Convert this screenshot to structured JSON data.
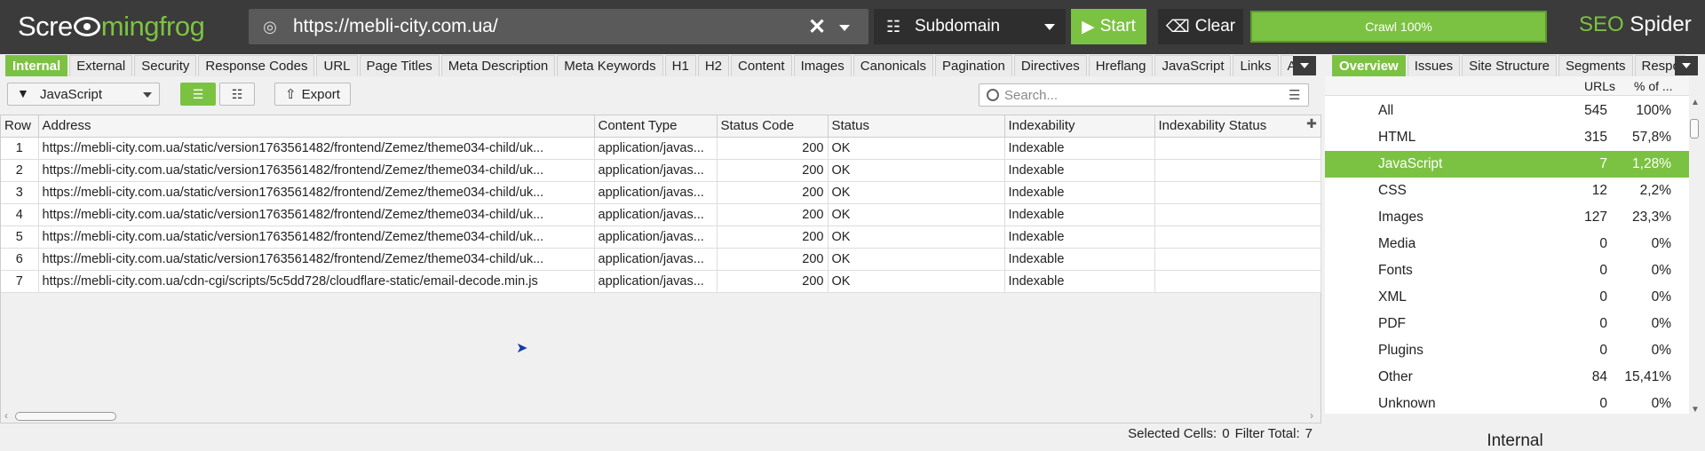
{
  "app": {
    "logo_left": "Scre",
    "logo_right": "mingfrog",
    "product_a": "SEO",
    "product_b": " Spider"
  },
  "toolbar": {
    "url": "https://mebli-city.com.ua/",
    "mode": "Subdomain",
    "start_label": "Start",
    "clear_label": "Clear",
    "crawl_status": "Crawl 100%"
  },
  "main_tabs": [
    "Internal",
    "External",
    "Security",
    "Response Codes",
    "URL",
    "Page Titles",
    "Meta Description",
    "Meta Keywords",
    "H1",
    "H2",
    "Content",
    "Images",
    "Canonicals",
    "Pagination",
    "Directives",
    "Hreflang",
    "JavaScript",
    "Links",
    "AM"
  ],
  "right_tabs": [
    "Overview",
    "Issues",
    "Site Structure",
    "Segments",
    "Respo"
  ],
  "filter": {
    "selected": "JavaScript",
    "export_label": "Export",
    "search_placeholder": "Search..."
  },
  "table": {
    "columns": [
      "Row",
      "Address",
      "Content Type",
      "Status Code",
      "Status",
      "Indexability",
      "Indexability Status"
    ],
    "rows": [
      [
        "1",
        "https://mebli-city.com.ua/static/version1763561482/frontend/Zemez/theme034-child/uk...",
        "application/javas...",
        "200",
        "OK",
        "Indexable",
        ""
      ],
      [
        "2",
        "https://mebli-city.com.ua/static/version1763561482/frontend/Zemez/theme034-child/uk...",
        "application/javas...",
        "200",
        "OK",
        "Indexable",
        ""
      ],
      [
        "3",
        "https://mebli-city.com.ua/static/version1763561482/frontend/Zemez/theme034-child/uk...",
        "application/javas...",
        "200",
        "OK",
        "Indexable",
        ""
      ],
      [
        "4",
        "https://mebli-city.com.ua/static/version1763561482/frontend/Zemez/theme034-child/uk...",
        "application/javas...",
        "200",
        "OK",
        "Indexable",
        ""
      ],
      [
        "5",
        "https://mebli-city.com.ua/static/version1763561482/frontend/Zemez/theme034-child/uk...",
        "application/javas...",
        "200",
        "OK",
        "Indexable",
        ""
      ],
      [
        "6",
        "https://mebli-city.com.ua/static/version1763561482/frontend/Zemez/theme034-child/uk...",
        "application/javas...",
        "200",
        "OK",
        "Indexable",
        ""
      ],
      [
        "7",
        "https://mebli-city.com.ua/cdn-cgi/scripts/5c5dd728/cloudflare-static/email-decode.min.js",
        "application/javas...",
        "200",
        "OK",
        "Indexable",
        ""
      ]
    ]
  },
  "status": {
    "selected_label": "Selected Cells:",
    "selected_value": "0",
    "filter_label": "Filter Total:",
    "filter_value": "7"
  },
  "overview": {
    "col_urls": "URLs",
    "col_pct": "% of ...",
    "rows": [
      {
        "name": "All",
        "urls": "545",
        "pct": "100%"
      },
      {
        "name": "HTML",
        "urls": "315",
        "pct": "57,8%"
      },
      {
        "name": "JavaScript",
        "urls": "7",
        "pct": "1,28%"
      },
      {
        "name": "CSS",
        "urls": "12",
        "pct": "2,2%"
      },
      {
        "name": "Images",
        "urls": "127",
        "pct": "23,3%"
      },
      {
        "name": "Media",
        "urls": "0",
        "pct": "0%"
      },
      {
        "name": "Fonts",
        "urls": "0",
        "pct": "0%"
      },
      {
        "name": "XML",
        "urls": "0",
        "pct": "0%"
      },
      {
        "name": "PDF",
        "urls": "0",
        "pct": "0%"
      },
      {
        "name": "Plugins",
        "urls": "0",
        "pct": "0%"
      },
      {
        "name": "Other",
        "urls": "84",
        "pct": "15,41%"
      },
      {
        "name": "Unknown",
        "urls": "0",
        "pct": "0%"
      }
    ],
    "footer": "Internal"
  }
}
